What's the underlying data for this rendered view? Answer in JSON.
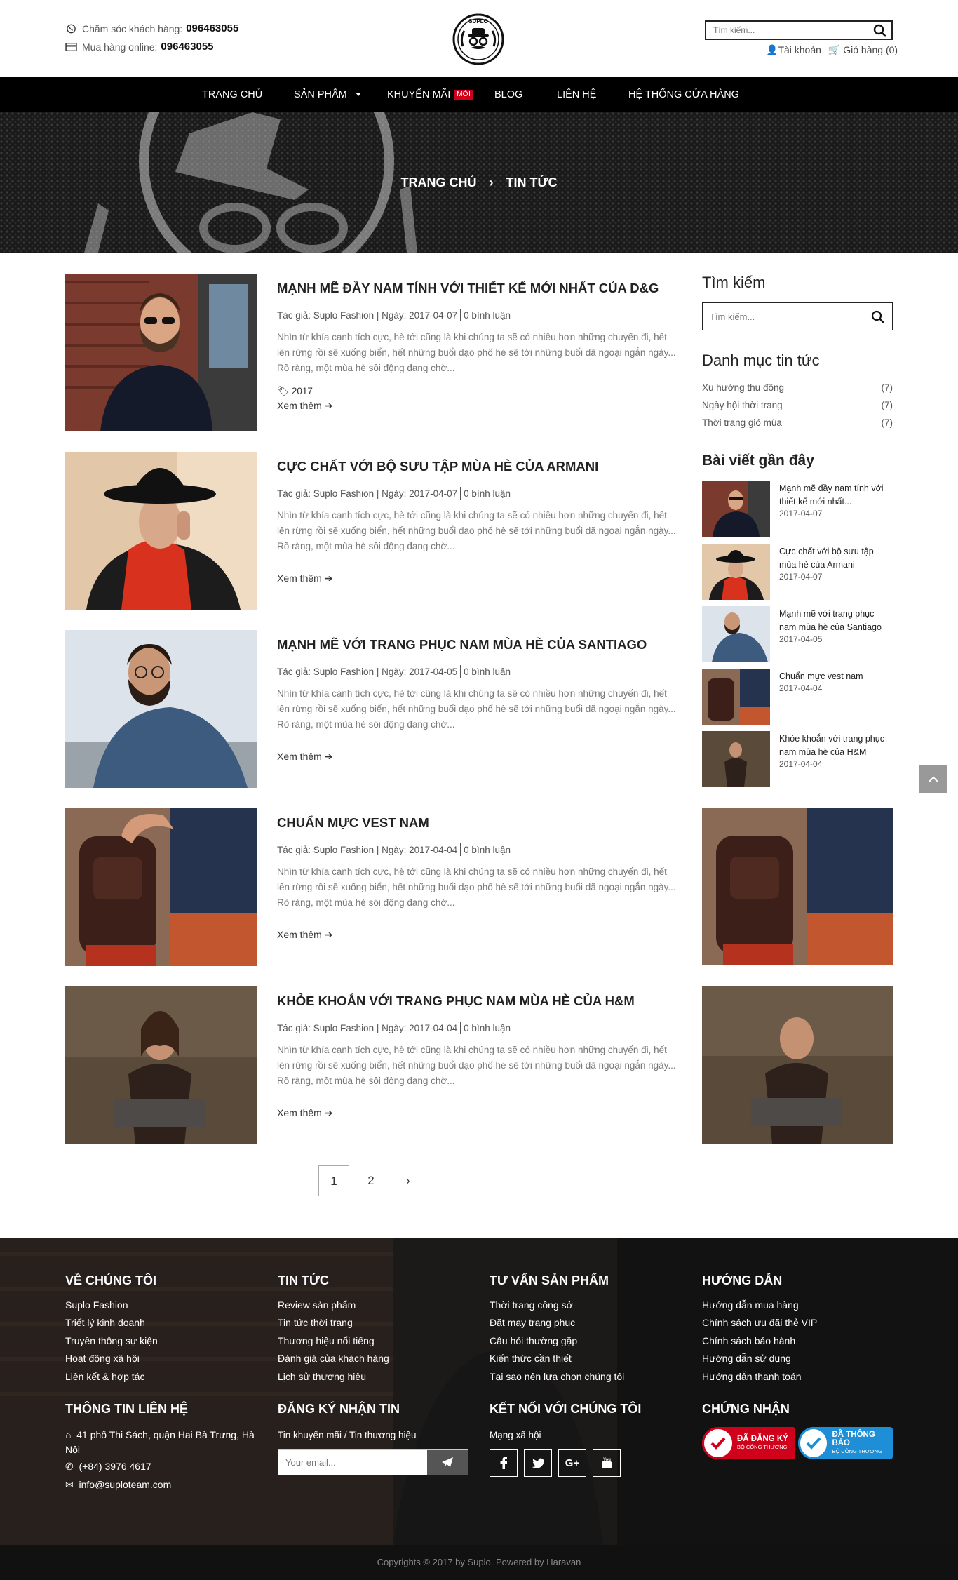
{
  "header": {
    "support_label": "Chăm sóc khách hàng:",
    "support_phone": "096463055",
    "online_label": "Mua hàng online:",
    "online_phone": "096463055",
    "logo_text": "SUPLO",
    "search_placeholder": "Tìm kiếm...",
    "account_label": "Tài khoản",
    "cart_label": "Giỏ hàng (0)"
  },
  "nav": {
    "items": [
      "TRANG CHỦ",
      "SẢN PHẨM",
      "KHUYẾN MÃI",
      "BLOG",
      "LIÊN HỆ",
      "HỆ THỐNG CỬA HÀNG"
    ],
    "hot_badge": "MỚI"
  },
  "breadcrumb": {
    "home": "TRANG CHỦ",
    "separator": "›",
    "current": "TIN TỨC"
  },
  "posts": [
    {
      "title": "MẠNH MẼ ĐẦY NAM TÍNH VỚI THIẾT KẾ MỚI NHẤT CỦA D&G",
      "author": "Tác giả: Suplo Fashion | Ngày: 2017-04-07",
      "comments": "0 bình luận",
      "excerpt": "Nhìn từ khía cạnh tích cực, hè tới cũng là khi chúng ta sẽ có nhiều hơn những chuyến đi, hết lên rừng rồi sẽ xuống biển, hết những buổi dạo phố hè sẽ tới những buổi dã ngoại ngắn ngày... Rõ ràng, một mùa hè sôi động đang chờ...",
      "tag": "2017",
      "more": "Xem thêm"
    },
    {
      "title": "CỰC CHẤT VỚI BỘ SƯU TẬP MÙA HÈ CỦA ARMANI",
      "author": "Tác giả: Suplo Fashion | Ngày: 2017-04-07",
      "comments": "0 bình luận",
      "excerpt": "Nhìn từ khía cạnh tích cực, hè tới cũng là khi chúng ta sẽ có nhiều hơn những chuyến đi, hết lên rừng rồi sẽ xuống biển, hết những buổi dạo phố hè sẽ tới những buổi dã ngoại ngắn ngày... Rõ ràng, một mùa hè sôi động đang chờ...",
      "more": "Xem thêm"
    },
    {
      "title": "MẠNH MẼ VỚI TRANG PHỤC NAM MÙA HÈ CỦA SANTIAGO",
      "author": "Tác giả: Suplo Fashion | Ngày: 2017-04-05",
      "comments": "0 bình luận",
      "excerpt": "Nhìn từ khía cạnh tích cực, hè tới cũng là khi chúng ta sẽ có nhiều hơn những chuyến đi, hết lên rừng rồi sẽ xuống biển, hết những buổi dạo phố hè sẽ tới những buổi dã ngoại ngắn ngày... Rõ ràng, một mùa hè sôi động đang chờ...",
      "more": "Xem thêm"
    },
    {
      "title": "CHUẨN MỰC VEST NAM",
      "author": "Tác giả: Suplo Fashion | Ngày: 2017-04-04",
      "comments": "0 bình luận",
      "excerpt": "Nhìn từ khía cạnh tích cực, hè tới cũng là khi chúng ta sẽ có nhiều hơn những chuyến đi, hết lên rừng rồi sẽ xuống biển, hết những buổi dạo phố hè sẽ tới những buổi dã ngoại ngắn ngày... Rõ ràng, một mùa hè sôi động đang chờ...",
      "more": "Xem thêm"
    },
    {
      "title": "KHỎE KHOẮN VỚI TRANG PHỤC NAM MÙA HÈ CỦA H&M",
      "author": "Tác giả: Suplo Fashion | Ngày: 2017-04-04",
      "comments": "0 bình luận",
      "excerpt": "Nhìn từ khía cạnh tích cực, hè tới cũng là khi chúng ta sẽ có nhiều hơn những chuyến đi, hết lên rừng rồi sẽ xuống biển, hết những buổi dạo phố hè sẽ tới những buổi dã ngoại ngắn ngày... Rõ ràng, một mùa hè sôi động đang chờ...",
      "more": "Xem thêm"
    }
  ],
  "pagination": {
    "pages": [
      "1",
      "2"
    ],
    "next": "›"
  },
  "sidebar": {
    "search_title": "Tìm kiếm",
    "search_placeholder": "Tìm kiếm...",
    "categories_title": "Danh mục tin tức",
    "categories": [
      {
        "name": "Xu hướng thu đông",
        "count": "(7)"
      },
      {
        "name": "Ngày hội thời trang",
        "count": "(7)"
      },
      {
        "name": "Thời trang gió mùa",
        "count": "(7)"
      }
    ],
    "recent_title": "Bài viết gần đây",
    "recent": [
      {
        "title": "Mạnh mẽ đầy nam tính với thiết kế mới nhất...",
        "date": "2017-04-07"
      },
      {
        "title": "Cực chất với bộ sưu tập mùa hè của Armani",
        "date": "2017-04-07"
      },
      {
        "title": "Mạnh mẽ với trang phục nam mùa hè của Santiago",
        "date": "2017-04-05"
      },
      {
        "title": "Chuẩn mực vest nam",
        "date": "2017-04-04"
      },
      {
        "title": "Khỏe khoắn với trang phục nam mùa hè của H&M",
        "date": "2017-04-04"
      }
    ]
  },
  "footer": {
    "about": {
      "title": "VỀ CHÚNG TÔI",
      "links": [
        "Suplo Fashion",
        "Triết lý kinh doanh",
        "Truyền thông sự kiện",
        "Hoạt động xã hội",
        "Liên kết & hợp tác"
      ]
    },
    "news": {
      "title": "TIN TỨC",
      "links": [
        "Review sản phẩm",
        "Tin tức thời trang",
        "Thương hiệu nổi tiếng",
        "Đánh giá của khách hàng",
        "Lịch sử thương hiệu"
      ]
    },
    "advice": {
      "title": "TƯ VẤN SẢN PHẨM",
      "links": [
        "Thời trang công sở",
        "Đặt may trang phục",
        "Câu hỏi thường gặp",
        "Kiến thức cần thiết",
        "Tại sao nên lựa chọn chúng tôi"
      ]
    },
    "guide": {
      "title": "HƯỚNG DẪN",
      "links": [
        "Hướng dẫn mua hàng",
        "Chính sách ưu đãi thẻ VIP",
        "Chính sách bảo hành",
        "Hướng dẫn sử dụng",
        "Hướng dẫn thanh toán"
      ]
    },
    "contact": {
      "title": "THÔNG TIN LIÊN HỆ",
      "address": "41 phố Thi Sách, quận Hai Bà Trưng, Hà Nội",
      "phone": "(+84) 3976 4617",
      "email": "info@suploteam.com"
    },
    "newsletter": {
      "title": "ĐĂNG KÝ NHẬN TIN",
      "subtitle": "Tin khuyến mãi / Tin thương hiệu",
      "placeholder": "Your email..."
    },
    "social": {
      "title": "KẾT NỐI VỚI CHÚNG TÔI",
      "subtitle": "Mạng xã hội",
      "icons": [
        "facebook-icon",
        "twitter-icon",
        "google-plus-icon",
        "youtube-icon"
      ]
    },
    "cert": {
      "title": "CHỨNG NHẬN",
      "badge1": "ĐÃ ĐĂNG KÝ",
      "badge1_sub": "BỘ CÔNG THƯƠNG",
      "badge2": "ĐÃ THÔNG BÁO",
      "badge2_sub": "BỘ CÔNG THƯƠNG"
    },
    "copyright": "Copyrights © 2017 by Suplo. Powered by Haravan"
  },
  "colors": {
    "accent_red": "#d0021b",
    "badge_blue": "#1e8fd6",
    "dark": "#000000"
  }
}
